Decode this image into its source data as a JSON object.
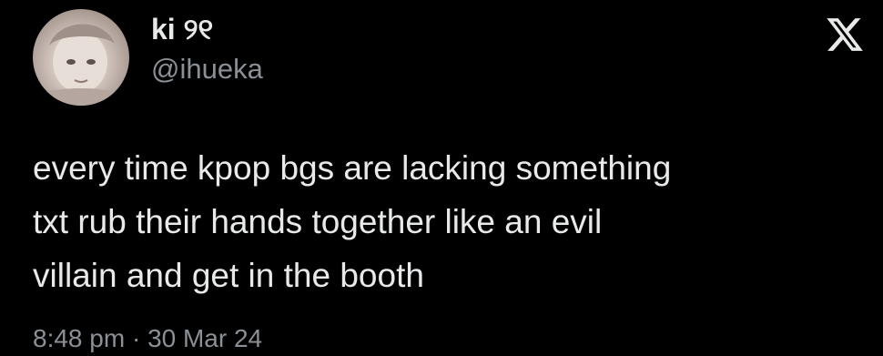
{
  "tweet": {
    "display_name": "ki ୨୧",
    "handle": "@ihueka",
    "text": "every time kpop bgs are lacking something\ntxt rub their hands together like an evil\nvillain and get in the booth",
    "time": "8:48 pm",
    "separator": "·",
    "date": "30 Mar 24"
  },
  "icons": {
    "brand": "x-logo-icon"
  },
  "colors": {
    "background": "#000000",
    "primary_text": "#e7e9ea",
    "secondary_text": "#8b9096"
  }
}
